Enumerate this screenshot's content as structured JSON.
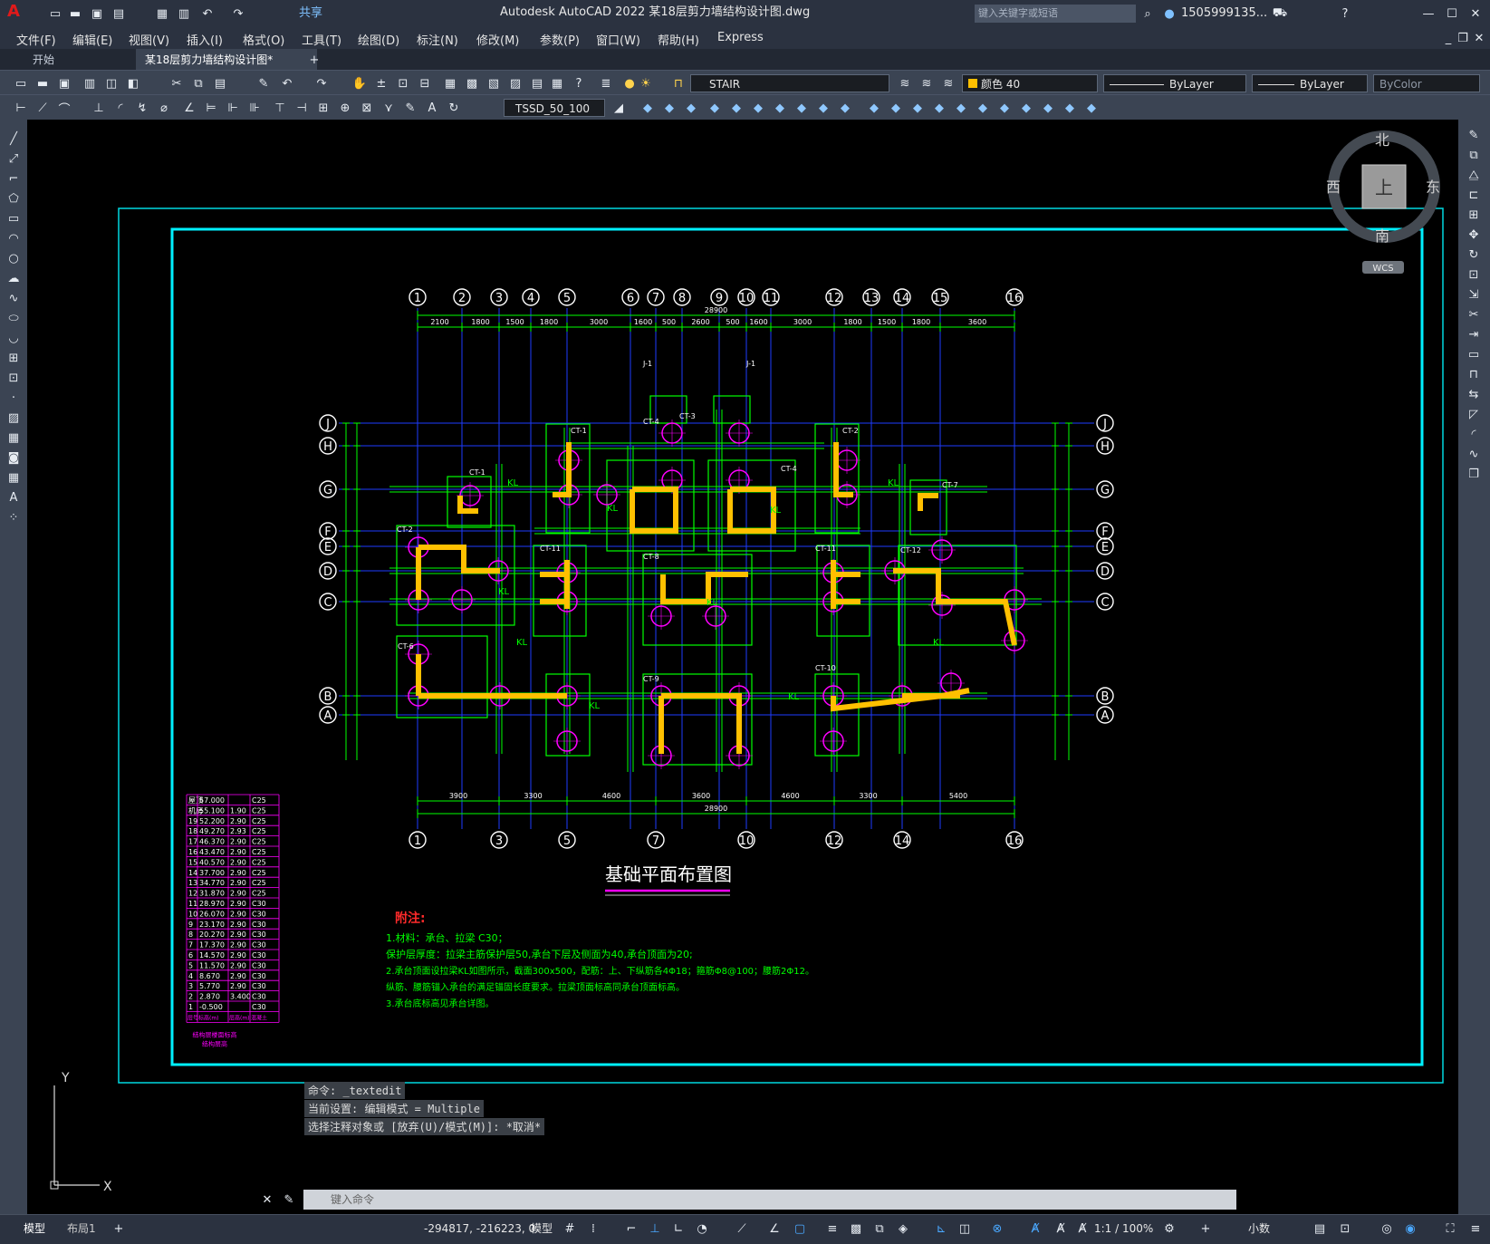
{
  "window": {
    "title": "Autodesk AutoCAD 2022    某18层剪力墙结构设计图.dwg",
    "share_label": "共享",
    "search_placeholder": "键入关键字或短语",
    "user": "1505999135..."
  },
  "menu": [
    "文件(F)",
    "编辑(E)",
    "视图(V)",
    "插入(I)",
    "格式(O)",
    "工具(T)",
    "绘图(D)",
    "标注(N)",
    "修改(M)",
    "参数(P)",
    "窗口(W)",
    "帮助(H)",
    "Express"
  ],
  "tabs": [
    {
      "label": "开始",
      "active": false
    },
    {
      "label": "某18层剪力墙结构设计图*",
      "active": true
    }
  ],
  "toolbar": {
    "layer": "STAIR",
    "color": "颜色 40",
    "linetype": "ByLayer",
    "lineweight": "ByLayer",
    "plotstyle": "ByColor",
    "dimstyle": "TSSD_50_100"
  },
  "viewcube": {
    "north": "北",
    "south": "南",
    "east": "东",
    "west": "西",
    "top": "上",
    "wcs": "WCS"
  },
  "drawing": {
    "title": "基础平面布置图",
    "notes_title": "附注:",
    "notes": [
      "1.材料：承台、拉梁  C30；",
      "   保护层厚度：拉梁主筋保护层50,承台下层及侧面为40,承台顶面为20;",
      "2.承台顶面设拉梁KL如图所示，截面300x500，配筋：上、下纵筋各4Φ18；箍筋Φ8@100；腰筋2Φ12。",
      "   纵筋、腰筋锚入承台的满足锚固长度要求。拉梁顶面标高同承台顶面标高。",
      "3.承台底标高见承台详图。"
    ],
    "top_axes": [
      "1",
      "2",
      "3",
      "4",
      "5",
      "6",
      "7",
      "8",
      "9",
      "10",
      "11",
      "12",
      "13",
      "14",
      "15",
      "16"
    ],
    "bottom_axes": [
      "1",
      "3",
      "5",
      "7",
      "10",
      "12",
      "14",
      "16"
    ],
    "row_axes": [
      "J",
      "H",
      "G",
      "F",
      "E",
      "D",
      "C",
      "B",
      "A"
    ],
    "top_dims": [
      "2100",
      "1800",
      "1500",
      "1800",
      "3000",
      "1600",
      "500",
      "2600",
      "500",
      "1600",
      "3000",
      "1800",
      "1500",
      "1800",
      "3600"
    ],
    "bottom_dims": [
      "3900",
      "3300",
      "4600",
      "3600",
      "4600",
      "3300",
      "5400"
    ],
    "total_dim": "28900",
    "labels": [
      "CT-1",
      "CT-2",
      "CT-3",
      "CT-4",
      "CT-5",
      "CT-6",
      "CT-7",
      "CT-8",
      "CT-9",
      "CT-10",
      "CT-11",
      "CT-12",
      "J-1",
      "KL"
    ]
  },
  "level_table": {
    "rows": [
      [
        "屋顶",
        "57.000",
        "",
        "C25"
      ],
      [
        "机房",
        "55.100",
        "1.90",
        "C25"
      ],
      [
        "19",
        "52.200",
        "2.90",
        "C25"
      ],
      [
        "18",
        "49.270",
        "2.93",
        "C25"
      ],
      [
        "17",
        "46.370",
        "2.90",
        "C25"
      ],
      [
        "16",
        "43.470",
        "2.90",
        "C25"
      ],
      [
        "15",
        "40.570",
        "2.90",
        "C25"
      ],
      [
        "14",
        "37.700",
        "2.90",
        "C25"
      ],
      [
        "13",
        "34.770",
        "2.90",
        "C25"
      ],
      [
        "12",
        "31.870",
        "2.90",
        "C25"
      ],
      [
        "11",
        "28.970",
        "2.90",
        "C30"
      ],
      [
        "10",
        "26.070",
        "2.90",
        "C30"
      ],
      [
        "9",
        "23.170",
        "2.90",
        "C30"
      ],
      [
        "8",
        "20.270",
        "2.90",
        "C30"
      ],
      [
        "7",
        "17.370",
        "2.90",
        "C30"
      ],
      [
        "6",
        "14.570",
        "2.90",
        "C30"
      ],
      [
        "5",
        "11.570",
        "2.90",
        "C30"
      ],
      [
        "4",
        "8.670",
        "2.90",
        "C30"
      ],
      [
        "3",
        "5.770",
        "2.90",
        "C30"
      ],
      [
        "2",
        "2.870",
        "3.400",
        "C30"
      ],
      [
        "1",
        "-0.500",
        "",
        "C30"
      ]
    ],
    "header": [
      "层号",
      "标高(m)",
      "层高(m)",
      "混凝土"
    ],
    "caption": "结构层楼面标高",
    "caption2": "结构层高"
  },
  "command": {
    "history": [
      "命令: _textedit",
      "当前设置: 编辑模式 = Multiple",
      "选择注释对象或 [放弃(U)/模式(M)]: *取消*"
    ],
    "placeholder": "键入命令"
  },
  "layout_tabs": [
    "模型",
    "布局1"
  ],
  "status": {
    "coords": "-294817, -216223, 0",
    "space": "模型",
    "scale": "1:1 / 100%",
    "units": "小数"
  },
  "colors": {
    "titlebar": "#2b3240",
    "toolbar": "#3b4453",
    "grid": "#1e3cff",
    "dim": "#00ff00",
    "wall": "#ffc000",
    "pile": "#ff00ff",
    "frame": "#00ffff"
  }
}
